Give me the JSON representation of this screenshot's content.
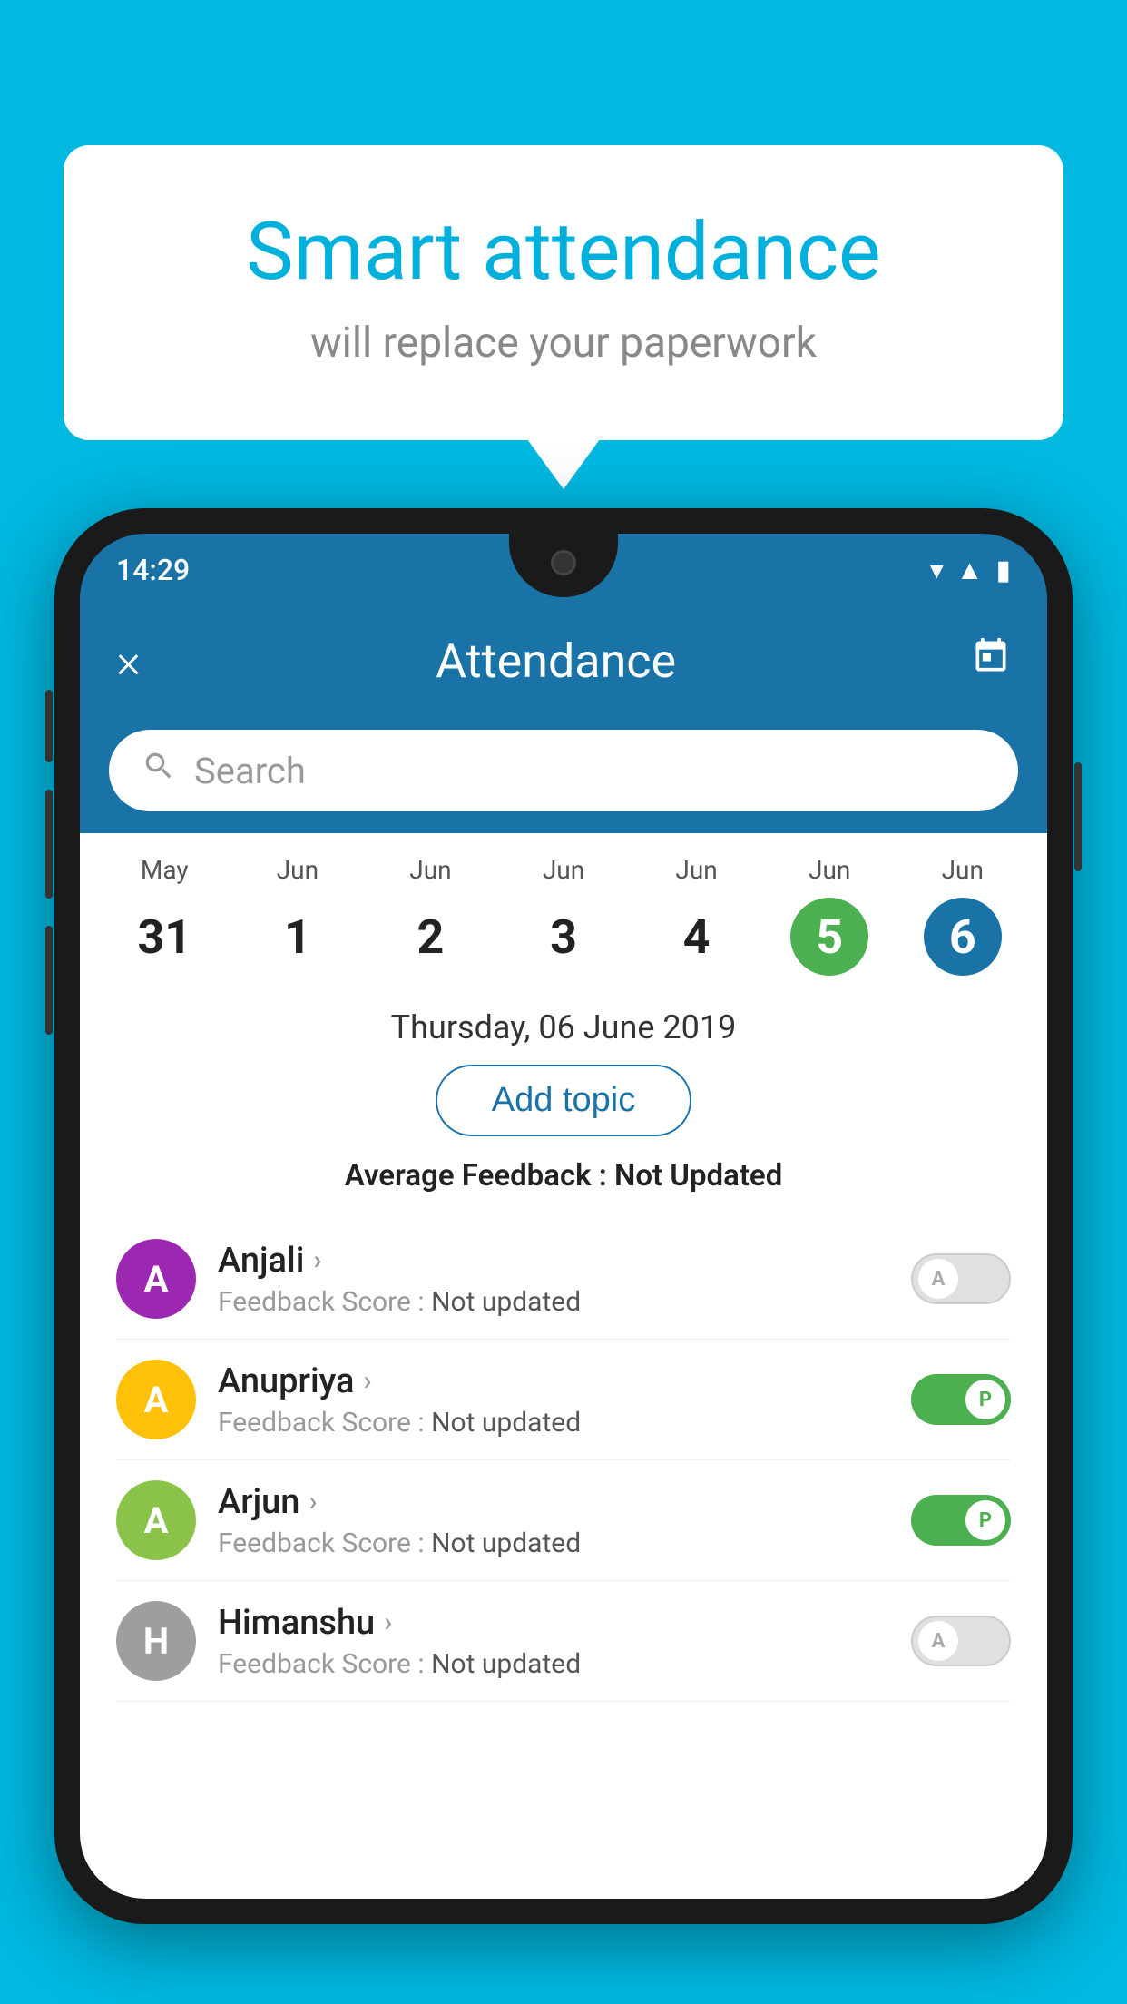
{
  "background_color": "#00B8E0",
  "bubble": {
    "title": "Smart attendance",
    "subtitle": "will replace your paperwork"
  },
  "phone": {
    "status_bar": {
      "time": "14:29"
    },
    "header": {
      "title": "Attendance",
      "close_label": "×",
      "calendar_label": "📅"
    },
    "search": {
      "placeholder": "Search"
    },
    "calendar": {
      "days": [
        {
          "month": "May",
          "date": "31",
          "state": "normal"
        },
        {
          "month": "Jun",
          "date": "1",
          "state": "normal"
        },
        {
          "month": "Jun",
          "date": "2",
          "state": "normal"
        },
        {
          "month": "Jun",
          "date": "3",
          "state": "normal"
        },
        {
          "month": "Jun",
          "date": "4",
          "state": "normal"
        },
        {
          "month": "Jun",
          "date": "5",
          "state": "today"
        },
        {
          "month": "Jun",
          "date": "6",
          "state": "selected"
        }
      ]
    },
    "selected_date": "Thursday, 06 June 2019",
    "add_topic_label": "Add topic",
    "avg_feedback_label": "Average Feedback : ",
    "avg_feedback_value": "Not Updated",
    "students": [
      {
        "name": "Anjali",
        "avatar_letter": "A",
        "avatar_color": "#9C27B0",
        "feedback_label": "Feedback Score : ",
        "feedback_value": "Not updated",
        "toggle_state": "off",
        "toggle_letter": "A"
      },
      {
        "name": "Anupriya",
        "avatar_letter": "A",
        "avatar_color": "#FFC107",
        "feedback_label": "Feedback Score : ",
        "feedback_value": "Not updated",
        "toggle_state": "on",
        "toggle_letter": "P"
      },
      {
        "name": "Arjun",
        "avatar_letter": "A",
        "avatar_color": "#8BC34A",
        "feedback_label": "Feedback Score : ",
        "feedback_value": "Not updated",
        "toggle_state": "on",
        "toggle_letter": "P"
      },
      {
        "name": "Himanshu",
        "avatar_letter": "H",
        "avatar_color": "#9E9E9E",
        "feedback_label": "Feedback Score : ",
        "feedback_value": "Not updated",
        "toggle_state": "off",
        "toggle_letter": "A"
      }
    ]
  }
}
